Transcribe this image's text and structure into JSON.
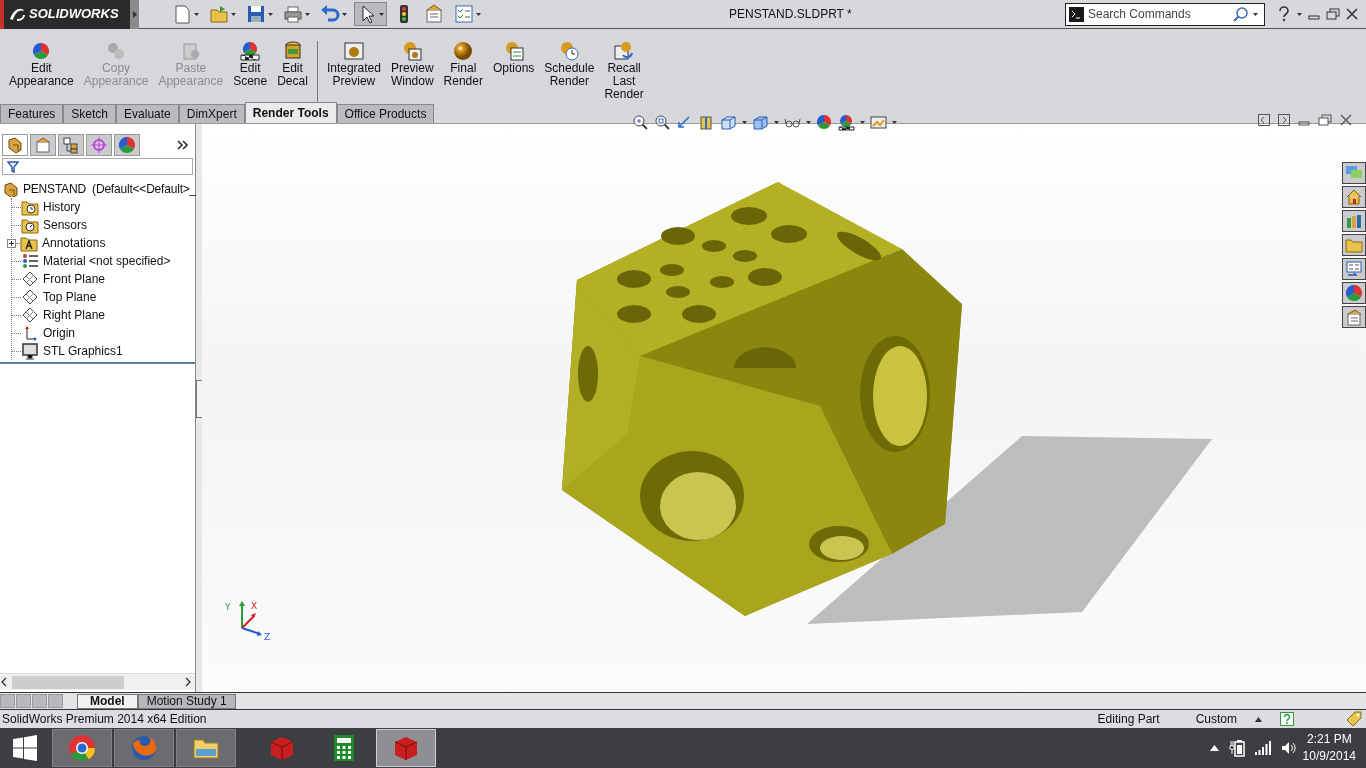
{
  "app": {
    "logo": "SOLIDWORKS"
  },
  "quick_toolbar": [
    {
      "kind": "new",
      "dropdown": true,
      "pressed": false
    },
    {
      "kind": "open",
      "dropdown": true,
      "pressed": false
    },
    {
      "kind": "save",
      "dropdown": true,
      "pressed": false
    },
    {
      "kind": "print",
      "dropdown": true,
      "pressed": false
    },
    {
      "kind": "undo",
      "dropdown": true,
      "pressed": false
    },
    {
      "kind": "select",
      "dropdown": true,
      "pressed": true
    },
    {
      "kind": "rebuild",
      "dropdown": false,
      "pressed": false
    },
    {
      "kind": "properties",
      "dropdown": false,
      "pressed": false
    },
    {
      "kind": "options",
      "dropdown": true,
      "pressed": false
    }
  ],
  "window": {
    "title": "PENSTAND.SLDPRT *"
  },
  "search": {
    "placeholder": "Search Commands"
  },
  "ribbon": {
    "groups": [
      [
        {
          "lines": [
            "Edit",
            "Appearance"
          ],
          "kind": "appearance",
          "disabled": false
        },
        {
          "lines": [
            "Copy",
            "Appearance"
          ],
          "kind": "copy",
          "disabled": true
        },
        {
          "lines": [
            "Paste",
            "Appearance"
          ],
          "kind": "paste",
          "disabled": true
        },
        {
          "lines": [
            "Edit",
            "Scene"
          ],
          "kind": "scene",
          "disabled": false
        },
        {
          "lines": [
            "Edit",
            "Decal"
          ],
          "kind": "decal",
          "disabled": false
        }
      ],
      [
        {
          "lines": [
            "Integrated",
            "Preview"
          ],
          "kind": "preview",
          "disabled": false
        },
        {
          "lines": [
            "Preview",
            "Window"
          ],
          "kind": "window",
          "disabled": false
        },
        {
          "lines": [
            "Final",
            "Render"
          ],
          "kind": "render",
          "disabled": false
        },
        {
          "lines": [
            "Options"
          ],
          "kind": "options",
          "disabled": false
        },
        {
          "lines": [
            "Schedule",
            "Render"
          ],
          "kind": "schedule",
          "disabled": false
        },
        {
          "lines": [
            "Recall",
            "Last",
            "Render"
          ],
          "kind": "recall",
          "disabled": false
        }
      ]
    ]
  },
  "tabs": [
    {
      "label": "Features",
      "selected": false
    },
    {
      "label": "Sketch",
      "selected": false
    },
    {
      "label": "Evaluate",
      "selected": false
    },
    {
      "label": "DimXpert",
      "selected": false
    },
    {
      "label": "Render Tools",
      "selected": true
    },
    {
      "label": "Office Products",
      "selected": false
    }
  ],
  "manager_tabs": [
    {
      "kind": "feature",
      "selected": true
    },
    {
      "kind": "property",
      "selected": false
    },
    {
      "kind": "config",
      "selected": false
    },
    {
      "kind": "dimxpert",
      "selected": false
    },
    {
      "kind": "display",
      "selected": false
    }
  ],
  "tree": {
    "root": "PENSTAND  (Default<<Default>_",
    "children": [
      {
        "label": "History",
        "kind": "history",
        "expandable": false
      },
      {
        "label": "Sensors",
        "kind": "sensors",
        "expandable": false
      },
      {
        "label": "Annotations",
        "kind": "annotations",
        "expandable": true
      },
      {
        "label": "Material <not specified>",
        "kind": "material",
        "expandable": false
      },
      {
        "label": "Front Plane",
        "kind": "plane",
        "expandable": false
      },
      {
        "label": "Top Plane",
        "kind": "plane",
        "expandable": false
      },
      {
        "label": "Right Plane",
        "kind": "plane",
        "expandable": false
      },
      {
        "label": "Origin",
        "kind": "origin",
        "expandable": false
      },
      {
        "label": "STL Graphics1",
        "kind": "graphics",
        "expandable": false
      }
    ]
  },
  "triad": [
    "Y",
    "X",
    "Z"
  ],
  "bottom_tabs": [
    {
      "label": "Model",
      "selected": true
    },
    {
      "label": "Motion Study 1",
      "selected": false
    }
  ],
  "status_bar": {
    "text": "SolidWorks Premium 2014 x64 Edition",
    "mode": "Editing Part",
    "units": "Custom"
  },
  "taskbar": {
    "apps": [
      {
        "kind": "chrome",
        "running": true,
        "selected": false
      },
      {
        "kind": "firefox",
        "running": true,
        "selected": false
      },
      {
        "kind": "explorer",
        "running": true,
        "selected": false
      },
      {
        "kind": "solidworks",
        "running": false,
        "selected": false
      },
      {
        "kind": "calculator",
        "running": false,
        "selected": false
      },
      {
        "kind": "solidworks",
        "running": true,
        "selected": true
      }
    ],
    "time": "2:21 PM",
    "date": "10/9/2014"
  }
}
